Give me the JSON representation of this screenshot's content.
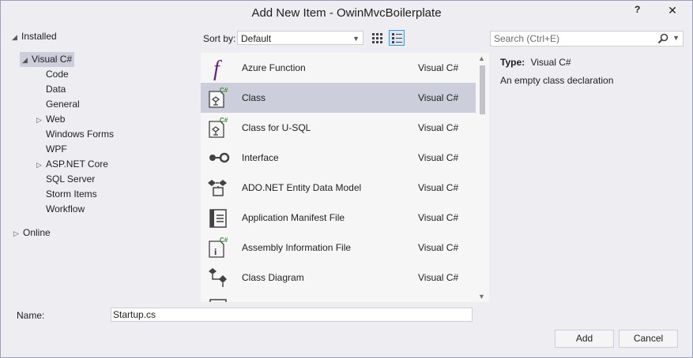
{
  "window": {
    "title": "Add New Item - OwinMvcBoilerplate",
    "help": "?",
    "close": "✕"
  },
  "tree": {
    "installed": "Installed",
    "visual_csharp": "Visual C#",
    "children": [
      "Code",
      "Data",
      "General",
      "Web",
      "Windows Forms",
      "WPF",
      "ASP.NET Core",
      "SQL Server",
      "Storm Items",
      "Workflow"
    ],
    "online": "Online"
  },
  "toolbar": {
    "sort_label": "Sort by:",
    "sort_value": "Default",
    "search_placeholder": "Search (Ctrl+E)"
  },
  "items": [
    {
      "name": "Azure Function",
      "lang": "Visual C#",
      "icon": "azure-function-icon"
    },
    {
      "name": "Class",
      "lang": "Visual C#",
      "icon": "class-icon",
      "selected": true
    },
    {
      "name": "Class for U-SQL",
      "lang": "Visual C#",
      "icon": "class-usql-icon"
    },
    {
      "name": "Interface",
      "lang": "Visual C#",
      "icon": "interface-icon"
    },
    {
      "name": "ADO.NET Entity Data Model",
      "lang": "Visual C#",
      "icon": "entity-model-icon"
    },
    {
      "name": "Application Manifest File",
      "lang": "Visual C#",
      "icon": "manifest-icon"
    },
    {
      "name": "Assembly Information File",
      "lang": "Visual C#",
      "icon": "assembly-info-icon"
    },
    {
      "name": "Class Diagram",
      "lang": "Visual C#",
      "icon": "class-diagram-icon"
    }
  ],
  "details": {
    "type_label": "Type:",
    "type_value": "Visual C#",
    "description": "An empty class declaration"
  },
  "bottom": {
    "name_label": "Name:",
    "name_value": "Startup.cs",
    "add": "Add",
    "cancel": "Cancel"
  },
  "colors": {
    "selection": "#cccedb",
    "accent": "#3399ff",
    "csharp_green": "#388a34",
    "function_purple": "#68217a"
  }
}
